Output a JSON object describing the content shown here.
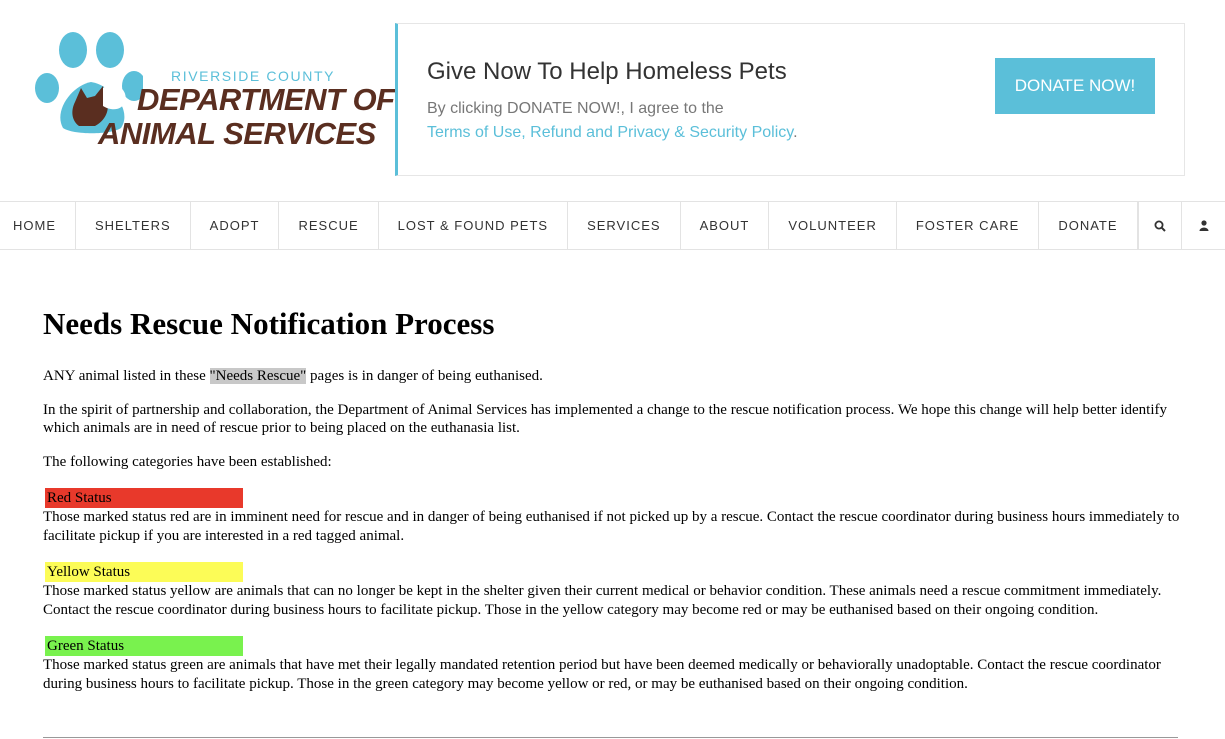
{
  "logo": {
    "subtitle": "RIVERSIDE COUNTY",
    "line1": "DEPARTMENT OF",
    "line2": "ANIMAL SERVICES"
  },
  "promo": {
    "title": "Give Now To Help Homeless Pets",
    "text": "By clicking DONATE NOW!, I agree to the",
    "link": "Terms of Use, Refund and Privacy & Security Policy",
    "link_suffix": ".",
    "button": "DONATE NOW!"
  },
  "nav": {
    "items": [
      "HOME",
      "SHELTERS",
      "ADOPT",
      "RESCUE",
      "LOST & FOUND PETS",
      "SERVICES",
      "ABOUT",
      "VOLUNTEER",
      "FOSTER CARE",
      "DONATE"
    ]
  },
  "content": {
    "title": "Needs Rescue Notification Process",
    "intro_before": "ANY animal listed in these ",
    "intro_highlight": "\"Needs Rescue\"",
    "intro_after": " pages is in danger of being euthanised.",
    "para2": "In the spirit of partnership and collaboration, the Department of Animal Services has implemented a change to the rescue notification process. We hope this change will help better identify which animals are in need of rescue prior to being placed on the euthanasia list.",
    "para3": "The following categories have been established:",
    "statuses": [
      {
        "label": "Red Status",
        "color": "#e8392b",
        "text": "Those marked status red are in imminent need for rescue and in danger of being euthanised if not picked up by a rescue. Contact the rescue coordinator during business hours immediately to facilitate pickup if you are interested in a red tagged animal."
      },
      {
        "label": "Yellow Status",
        "color": "#fcfc57",
        "text": "Those marked status yellow are animals that can no longer be kept in the shelter given their current medical or behavior condition. These animals need a rescue commitment immediately. Contact the rescue coordinator during business hours to facilitate pickup. Those in the yellow category may become red or may be euthanised based on their ongoing condition."
      },
      {
        "label": "Green Status",
        "color": "#79f24e",
        "text": "Those marked status green are animals that have met their legally mandated retention period but have been deemed medically or behaviorally unadoptable. Contact the rescue coordinator during business hours to facilitate pickup. Those in the green category may become yellow or red, or may be euthanised based on their ongoing condition."
      }
    ]
  },
  "icons": {
    "paw": "paw-logo-icon",
    "search": "search-icon",
    "user": "user-icon"
  },
  "colors": {
    "accent": "#5bbfd9",
    "brand_brown": "#5a2e20"
  }
}
